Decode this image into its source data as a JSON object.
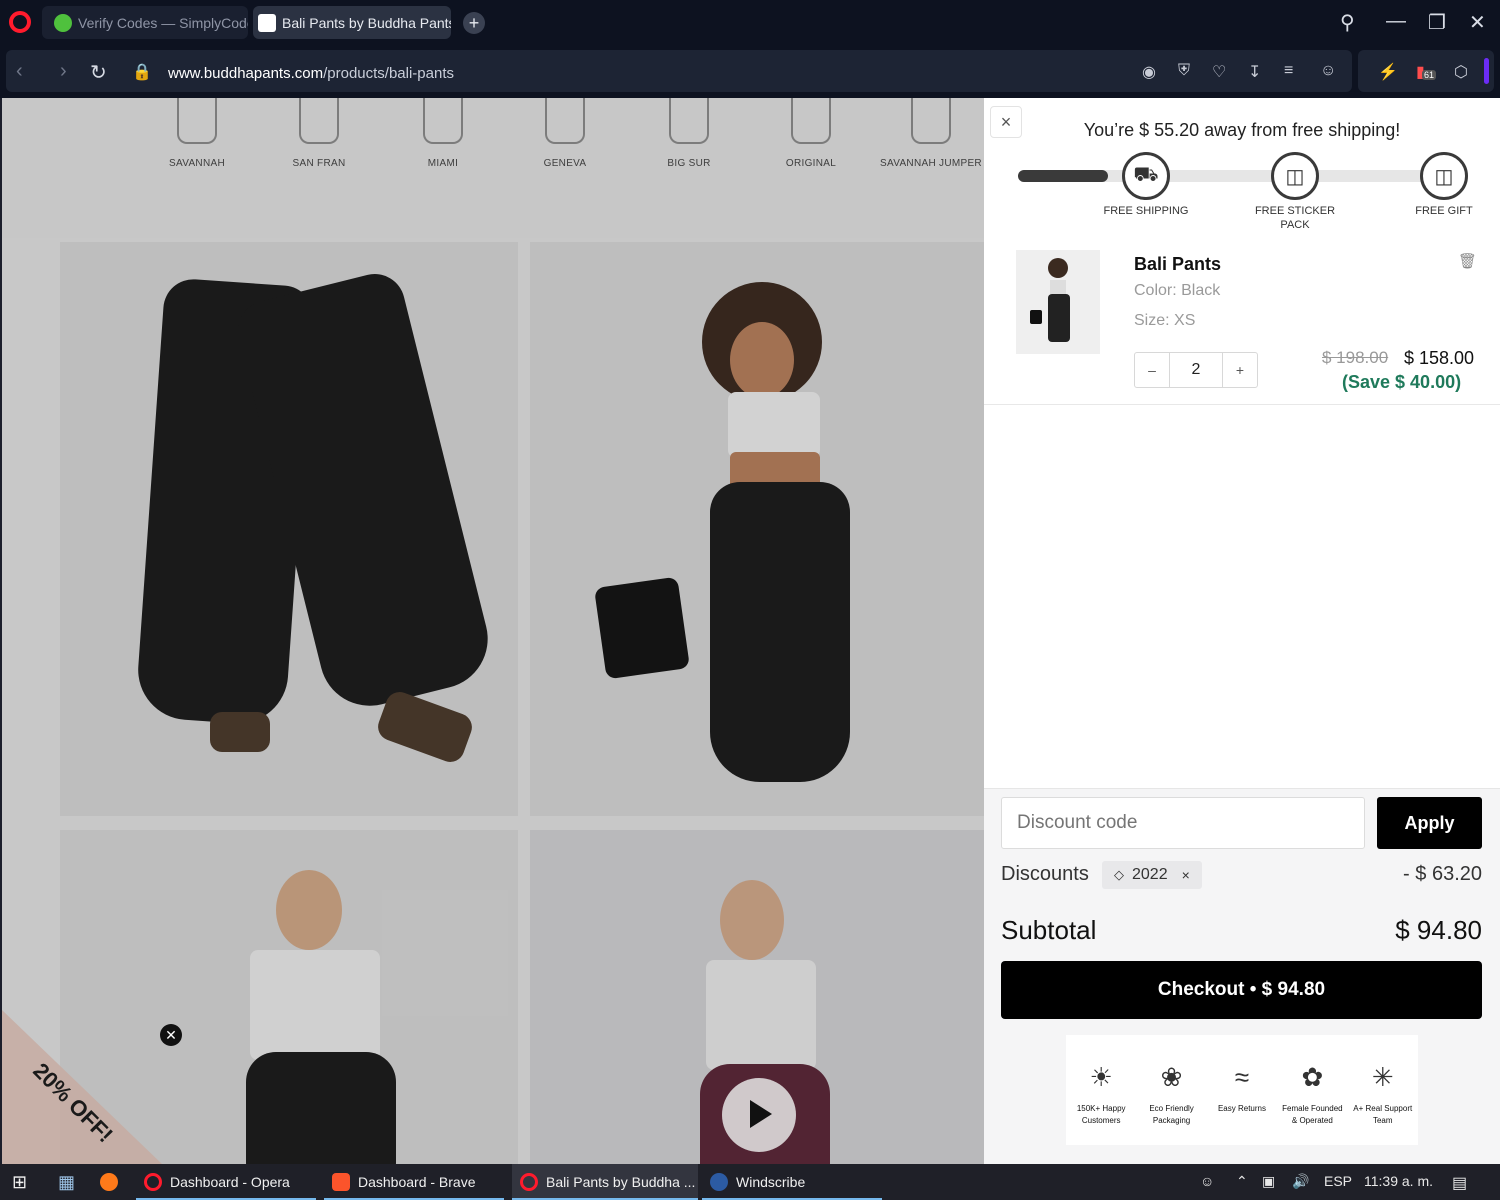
{
  "browser": {
    "tabs": [
      {
        "label": "Verify Codes — SimplyCodes",
        "active": false
      },
      {
        "label": "Bali Pants by Buddha Pants",
        "active": true
      }
    ],
    "url_domain": "www.buddhapants.com",
    "url_path": "/products/bali-pants",
    "badge_count": "61"
  },
  "page": {
    "styles": [
      "SAVANNAH",
      "SAN FRAN",
      "MIAMI",
      "GENEVA",
      "BIG SUR",
      "ORIGINAL",
      "SAVANNAH JUMPER"
    ],
    "promo_text": "20% OFF!"
  },
  "cart": {
    "shipping_message": "You’re $ 55.20 away from free shipping!",
    "progress_fraction": 0.2,
    "milestones": [
      "FREE SHIPPING",
      "FREE STICKER PACK",
      "FREE GIFT"
    ],
    "item": {
      "title": "Bali Pants",
      "color": "Color: Black",
      "size": "Size: XS",
      "quantity": "2",
      "price_original": "$ 198.00",
      "price_current": "$ 158.00",
      "savings": "(Save $ 40.00)"
    },
    "discount_placeholder": "Discount code",
    "apply_label": "Apply",
    "discounts_label": "Discounts",
    "discount_code": "2022",
    "discount_amount": "- $ 63.20",
    "subtotal_label": "Subtotal",
    "subtotal_amount": "$ 94.80",
    "checkout_label": "Checkout • $ 94.80",
    "badges": [
      "150K+ Happy Customers",
      "Eco Friendly Packaging",
      "Easy Returns",
      "Female Founded & Operated",
      "A+ Real Support Team"
    ]
  },
  "taskbar": {
    "items": [
      "Dashboard - Opera",
      "Dashboard - Brave",
      "Bali Pants by Buddha ...",
      "Windscribe"
    ],
    "language": "ESP",
    "time": "11:39 a. m."
  },
  "colors": {
    "accent_save": "#1f7a5b",
    "tab_indicator": "#6b2cf5",
    "opera_red": "#ff1b2d"
  }
}
